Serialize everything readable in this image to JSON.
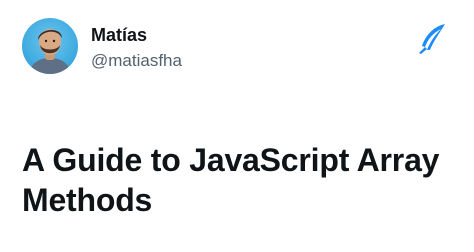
{
  "author": {
    "name": "Matías",
    "handle": "@matiasfha",
    "avatar_icon": "profile-avatar-photo"
  },
  "brand": {
    "logo_icon": "feather-pen-logo-icon",
    "color": "#1d8cf8"
  },
  "post": {
    "title": "A Guide to JavaScript Array Methods"
  }
}
